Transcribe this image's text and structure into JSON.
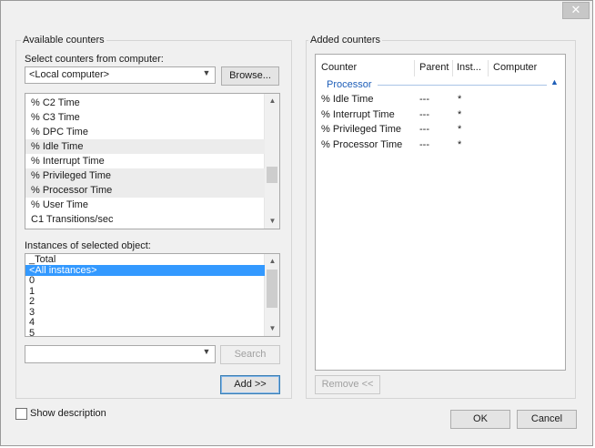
{
  "window": {
    "close_glyph": "✕",
    "close_icon": "close-icon"
  },
  "left": {
    "group_title": "Available counters",
    "computer_label": "Select counters from computer:",
    "computer_value": "<Local computer>",
    "browse_label": "Browse...",
    "counters": [
      "% C2 Time",
      "% C3 Time",
      "% DPC Time",
      "% Idle Time",
      "% Interrupt Time",
      "% Privileged Time",
      "% Processor Time",
      "% User Time",
      "C1 Transitions/sec"
    ],
    "instances_label": "Instances of selected object:",
    "instances": [
      "_Total",
      "<All instances>",
      "0",
      "1",
      "2",
      "3",
      "4",
      "5"
    ],
    "selected_instance": "<All instances>",
    "search_value": "",
    "search_label": "Search",
    "add_label": "Add >>"
  },
  "right": {
    "group_title": "Added counters",
    "columns": [
      "Counter",
      "Parent",
      "Inst...",
      "Computer"
    ],
    "object_name": "Processor",
    "rows": [
      {
        "counter": "% Idle Time",
        "parent": "---",
        "instance": "*",
        "computer": ""
      },
      {
        "counter": "% Interrupt Time",
        "parent": "---",
        "instance": "*",
        "computer": ""
      },
      {
        "counter": "% Privileged Time",
        "parent": "---",
        "instance": "*",
        "computer": ""
      },
      {
        "counter": "% Processor Time",
        "parent": "---",
        "instance": "*",
        "computer": ""
      }
    ],
    "remove_label": "Remove <<"
  },
  "footer": {
    "show_description_label": "Show description",
    "ok_label": "OK",
    "cancel_label": "Cancel"
  },
  "colors": {
    "selection": "#3399ff",
    "group_link": "#1e5eb8"
  }
}
